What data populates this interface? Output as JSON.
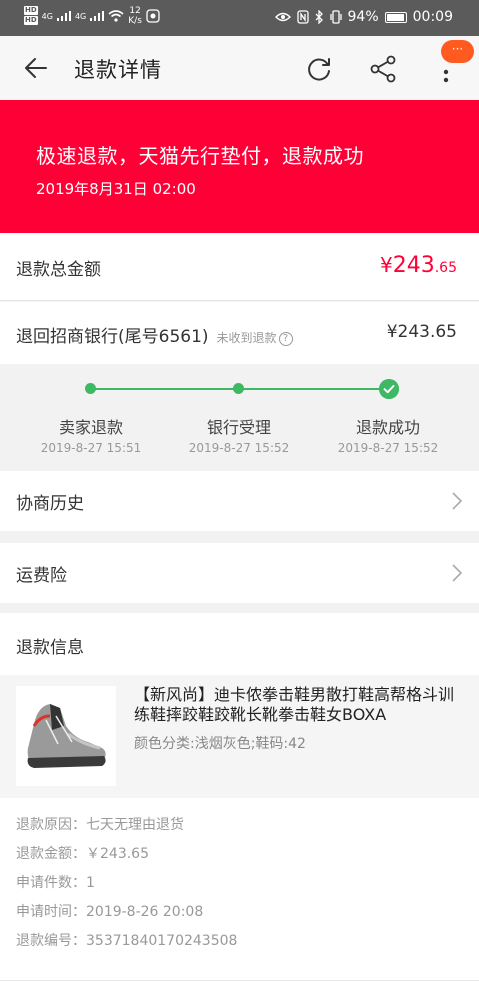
{
  "status_bar": {
    "hd_top": "HD",
    "hd_bottom": "HD",
    "net1": "4G",
    "net2": "4G",
    "speed_value": "12",
    "speed_unit": "K/s",
    "battery": "94%",
    "time": "00:09"
  },
  "nav": {
    "title": "退款详情",
    "badge": "···"
  },
  "banner": {
    "title": "极速退款，天猫先行垫付，退款成功",
    "date": "2019年8月31日 02:00"
  },
  "total": {
    "label": "退款总金额",
    "currency": "¥",
    "integer": "243",
    "decimal": ".65"
  },
  "bank": {
    "label": "退回招商银行(尾号6561)",
    "note": "未收到退款",
    "help": "?",
    "amount": "¥243.65"
  },
  "progress": {
    "steps": [
      {
        "name": "卖家退款",
        "time": "2019-8-27 15:51"
      },
      {
        "name": "银行受理",
        "time": "2019-8-27 15:52"
      },
      {
        "name": "退款成功",
        "time": "2019-8-27 15:52"
      }
    ]
  },
  "menu": {
    "history": "协商历史",
    "freight": "运费险"
  },
  "refund_info": {
    "title": "退款信息",
    "product_name": "【新风尚】迪卡侬拳击鞋男散打鞋高帮格斗训练鞋摔跤鞋跤靴长靴拳击鞋女BOXA",
    "product_sku": "颜色分类:浅烟灰色;鞋码:42",
    "details": [
      "退款原因：七天无理由退货",
      "退款金额：￥243.65",
      "申请件数：1",
      "申请时间：2019-8-26 20:08",
      "退款编号：35371840170243508"
    ]
  },
  "colors": {
    "banner_red": "#ff0036",
    "progress_green": "#3cb962",
    "badge_orange": "#ff5a1f"
  }
}
